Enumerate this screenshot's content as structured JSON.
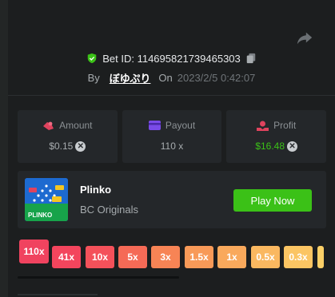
{
  "bet": {
    "id_text": "Bet ID: 114695821739465303",
    "by_label": "By",
    "username": "ぼゆぷり",
    "on_label": "On",
    "datetime": "2023/2/5 0:42:07"
  },
  "stats": {
    "amount": {
      "label": "Amount",
      "value": "$0.15"
    },
    "payout": {
      "label": "Payout",
      "value": "110 x"
    },
    "profit": {
      "label": "Profit",
      "value": "$16.48"
    }
  },
  "game": {
    "name": "Plinko",
    "provider": "BC Originals",
    "play_label": "Play Now",
    "thumb_text": "PLINKO"
  },
  "multipliers": [
    "110x",
    "41x",
    "10x",
    "5x",
    "3x",
    "1.5x",
    "1x",
    "0.5x",
    "0.3x"
  ],
  "colors": {
    "accent_green": "#3bc117",
    "amount_icon": "#e0435e",
    "payout_icon": "#7a4be8",
    "profit_icon": "#e0435e",
    "shield": "#3bc117"
  },
  "icons": [
    "share-icon",
    "shield-check-icon",
    "copy-icon",
    "amount-icon",
    "payout-card-icon",
    "profit-icon",
    "close-circle-icon"
  ]
}
